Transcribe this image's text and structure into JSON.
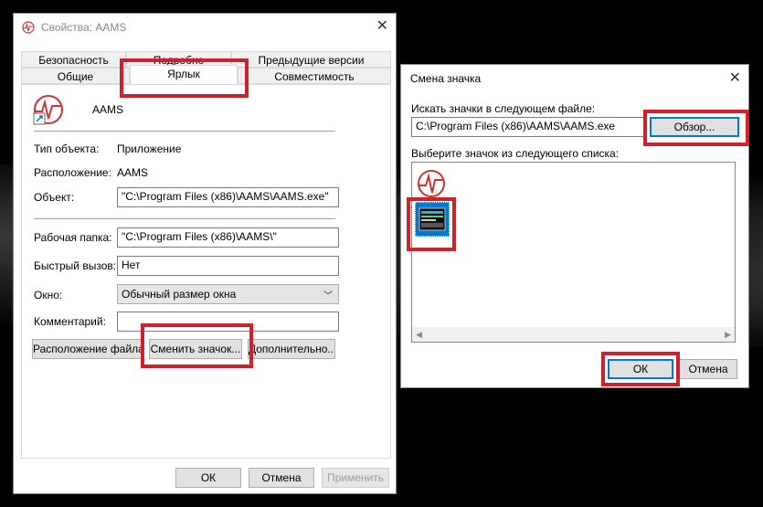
{
  "props": {
    "title": "Свойства: AAMS",
    "tabs_top": [
      "Безопасность",
      "Подробно",
      "Предыдущие версии"
    ],
    "tabs_bottom": [
      "Общие",
      "Ярлык",
      "Совместимость"
    ],
    "app_name": "AAMS",
    "fields": {
      "type_label": "Тип объекта:",
      "type_value": "Приложение",
      "location_label": "Расположение:",
      "location_value": "AAMS",
      "object_label": "Объект:",
      "object_value": "\"C:\\Program Files (x86)\\AAMS\\AAMS.exe\"",
      "workdir_label": "Рабочая папка:",
      "workdir_value": "\"C:\\Program Files (x86)\\AAMS\\\"",
      "hotkey_label": "Быстрый вызов:",
      "hotkey_value": "Нет",
      "window_label": "Окно:",
      "window_value": "Обычный размер окна",
      "comment_label": "Комментарий:",
      "comment_value": ""
    },
    "buttons": {
      "file_location": "Расположение файла",
      "change_icon": "Сменить значок...",
      "advanced": "Дополнительно...",
      "ok": "ОК",
      "cancel": "Отмена",
      "apply": "Применить"
    }
  },
  "change_icon": {
    "title": "Смена значка",
    "search_label": "Искать значки в следующем файле:",
    "file_value": "C:\\Program Files (x86)\\AAMS\\AAMS.exe",
    "browse": "Обзор...",
    "list_label": "Выберите значок из следующего списка:",
    "ok": "ОК",
    "cancel": "Отмена"
  },
  "colors": {
    "highlight": "#d0202a",
    "accent": "#0078d7"
  }
}
